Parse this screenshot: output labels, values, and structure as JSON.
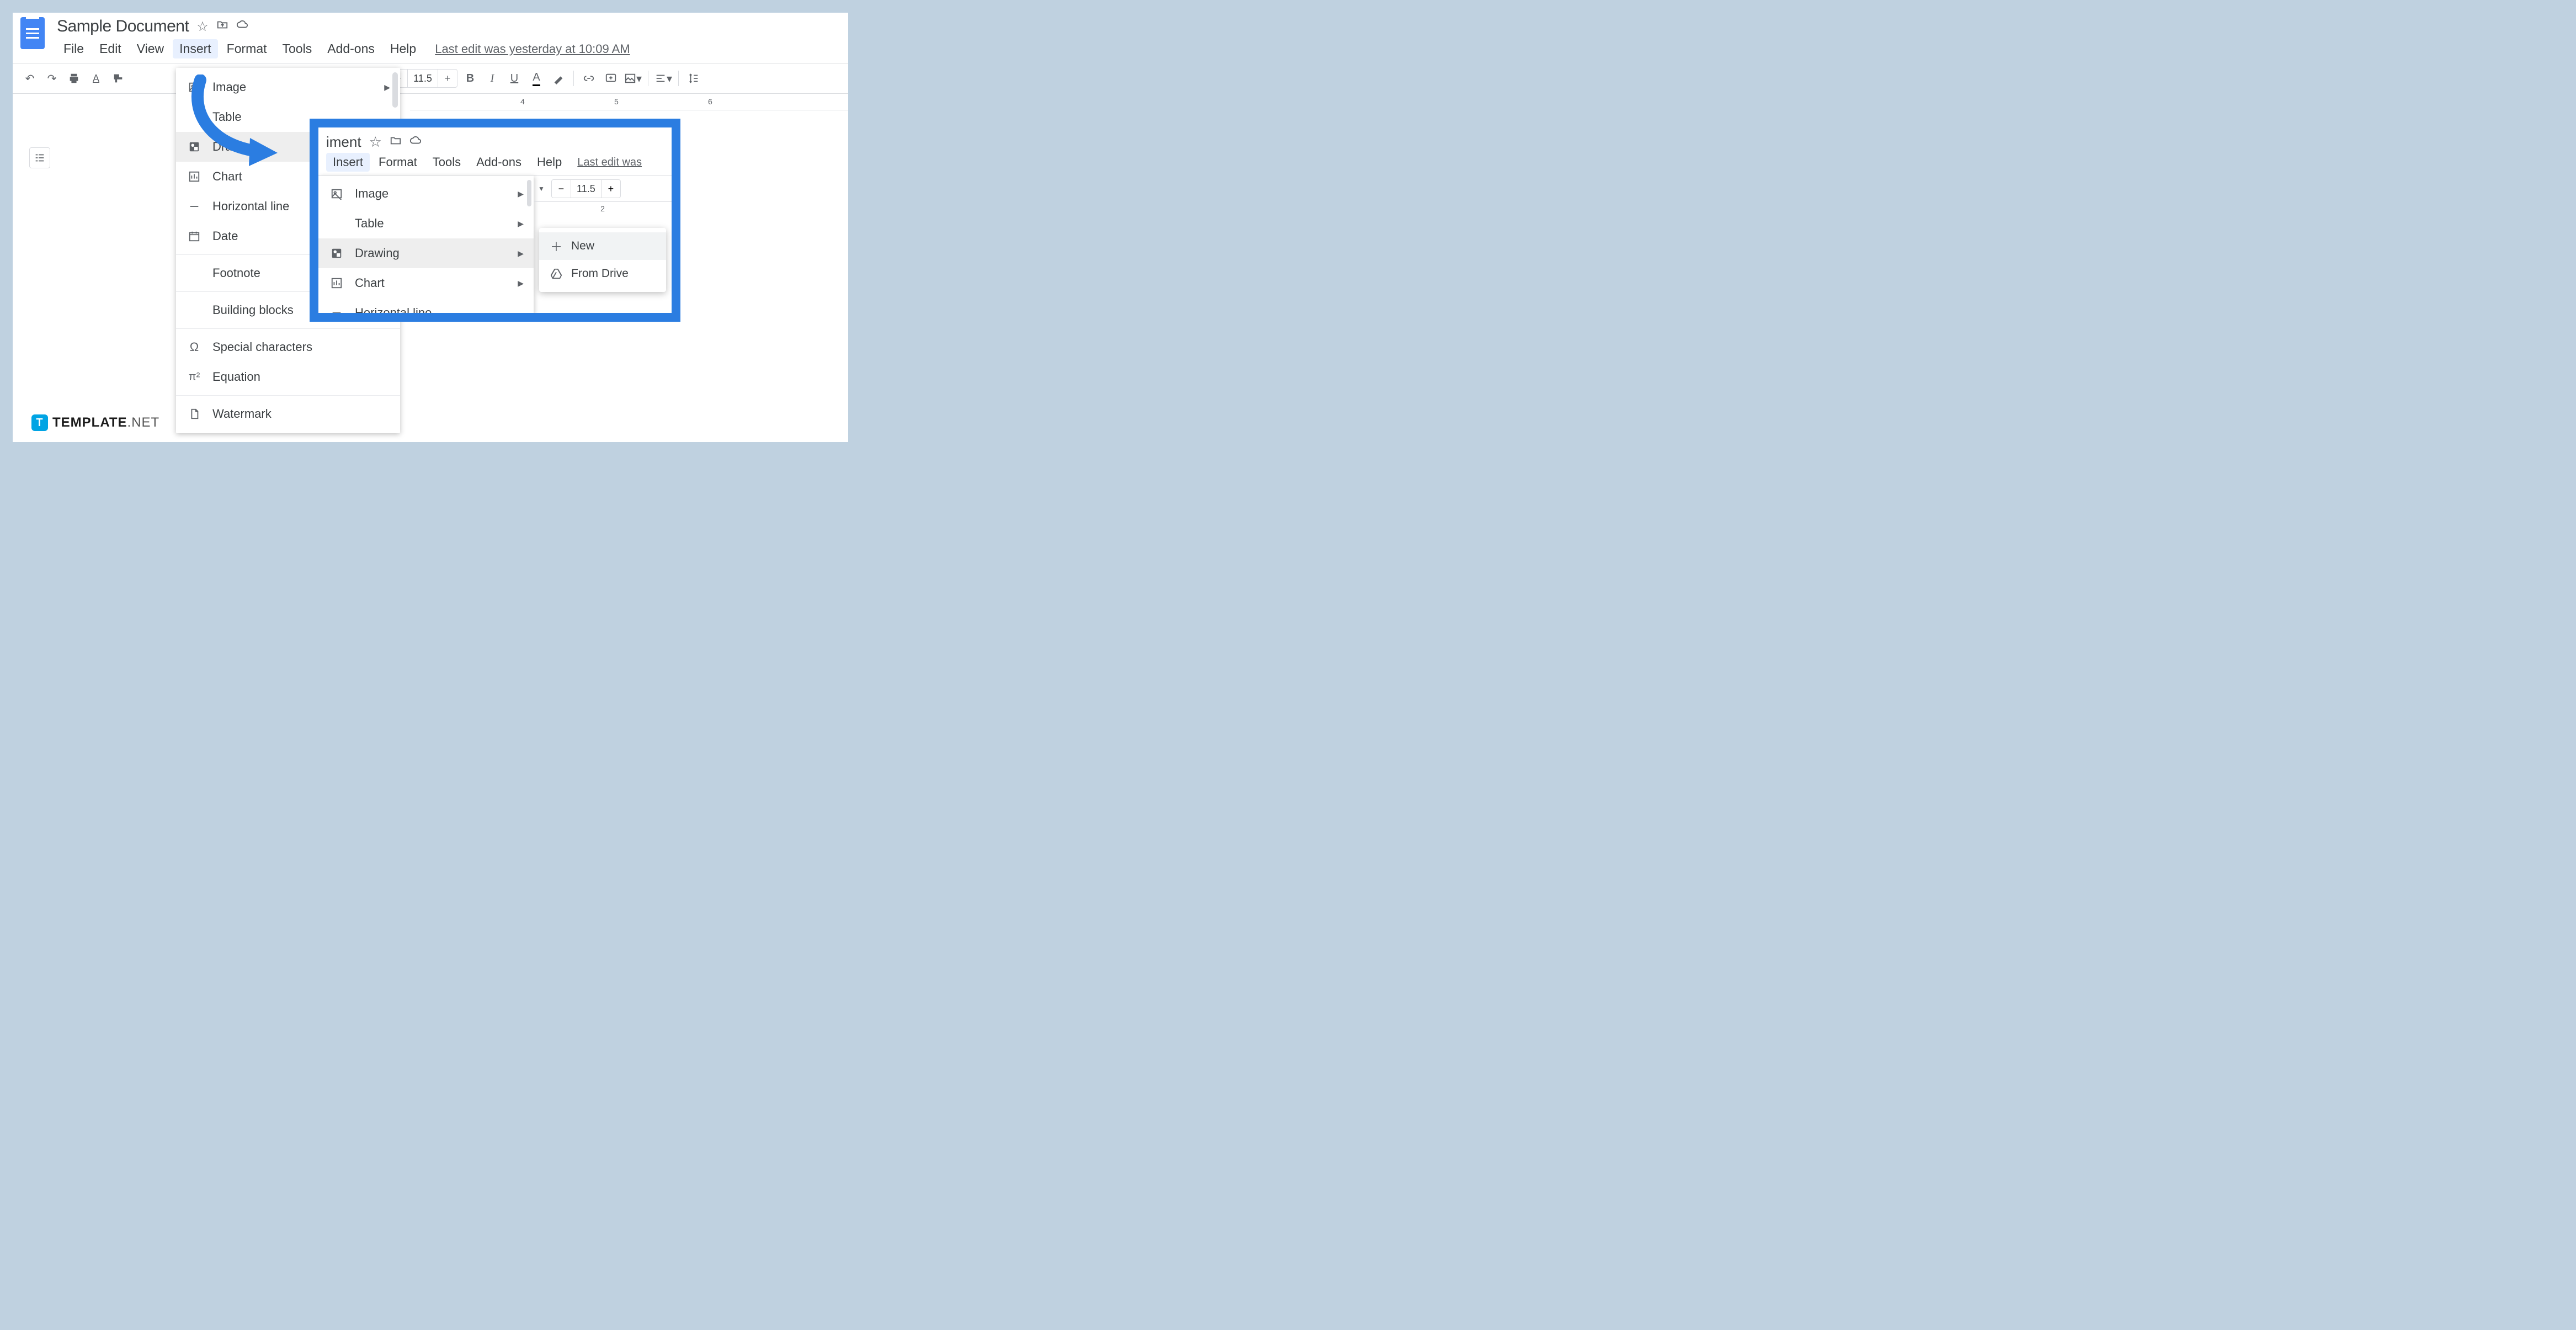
{
  "document": {
    "title": "Sample Document"
  },
  "menubar": {
    "items": [
      "File",
      "Edit",
      "View",
      "Insert",
      "Format",
      "Tools",
      "Add-ons",
      "Help"
    ],
    "last_edit": "Last edit was yesterday at 10:09 AM"
  },
  "toolbar": {
    "font_size": "11.5",
    "minus": "−",
    "plus": "+"
  },
  "ruler": {
    "mark4": "4",
    "mark5": "5",
    "mark6": "6"
  },
  "insert_menu": {
    "image": "Image",
    "table": "Table",
    "drawing": "Drawing",
    "chart": "Chart",
    "hline": "Horizontal line",
    "date": "Date",
    "footnote": "Footnote",
    "bblocks": "Building blocks",
    "special": "Special characters",
    "equation": "Equation",
    "watermark": "Watermark"
  },
  "inset": {
    "title_fragment": "iment",
    "menubar": [
      "Insert",
      "Format",
      "Tools",
      "Add-ons",
      "Help"
    ],
    "last_edit": "Last edit was ",
    "font_size": "11.5",
    "minus": "−",
    "plus": "+",
    "dropdown": {
      "image": "Image",
      "table": "Table",
      "drawing": "Drawing",
      "chart": "Chart",
      "hline": "Horizontal line"
    },
    "ruler_mark": "2"
  },
  "submenu": {
    "new": "New",
    "from_drive": "From Drive"
  },
  "branding": {
    "strong": "TEMPLATE",
    "light": ".NET"
  }
}
